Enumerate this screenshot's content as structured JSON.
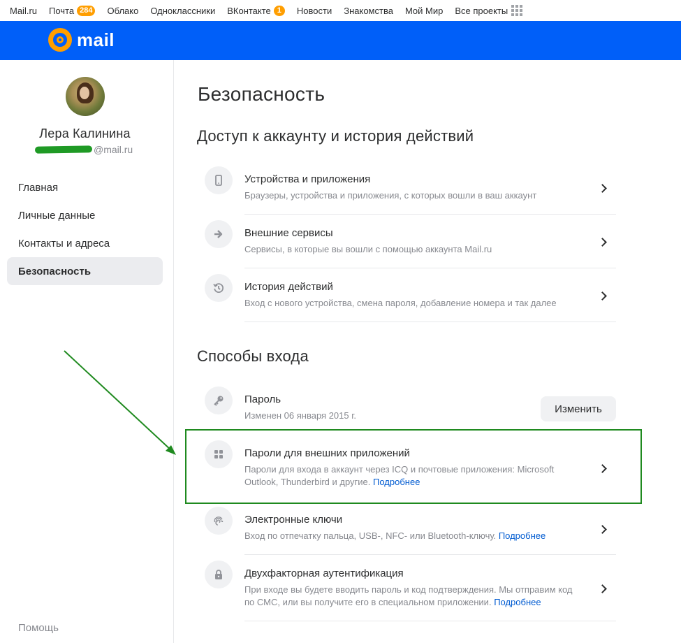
{
  "portal": {
    "items": [
      {
        "label": "Mail.ru"
      },
      {
        "label": "Почта",
        "badge": "284"
      },
      {
        "label": "Облако"
      },
      {
        "label": "Одноклассники"
      },
      {
        "label": "ВКонтакте",
        "badge": "1"
      },
      {
        "label": "Новости"
      },
      {
        "label": "Знакомства"
      },
      {
        "label": "Мой Мир"
      },
      {
        "label": "Все проекты"
      }
    ]
  },
  "header": {
    "logo_text": "mail"
  },
  "user": {
    "name": "Лера Калинина",
    "email_suffix": "@mail.ru"
  },
  "nav": {
    "items": [
      {
        "label": "Главная"
      },
      {
        "label": "Личные данные"
      },
      {
        "label": "Контакты и адреса"
      },
      {
        "label": "Безопасность",
        "active": true
      }
    ],
    "help": "Помощь"
  },
  "page": {
    "title": "Безопасность"
  },
  "access_section": {
    "title": "Доступ к аккаунту и история действий",
    "rows": [
      {
        "title": "Устройства и приложения",
        "desc": "Браузеры, устройства и приложения, с которых вошли в ваш аккаунт",
        "icon": "phone-icon"
      },
      {
        "title": "Внешние сервисы",
        "desc": "Сервисы, в которые вы вошли с помощью аккаунта Mail.ru",
        "icon": "arrow-right-icon"
      },
      {
        "title": "История действий",
        "desc": "Вход с нового устройства, смена пароля, добавление номера и так далее",
        "icon": "history-icon"
      }
    ]
  },
  "login_section": {
    "title": "Способы входа",
    "password": {
      "title": "Пароль",
      "desc": "Изменен 06 января 2015 г.",
      "button": "Изменить",
      "icon": "key-icon"
    },
    "app_passwords": {
      "title": "Пароли для внешних приложений",
      "desc": "Пароли для входа в аккаунт через ICQ и почтовые приложения: Microsoft Outlook, Thunderbird и другие.",
      "link": "Подробнее",
      "icon": "apps-grid-icon"
    },
    "keys": {
      "title": "Электронные ключи",
      "desc": "Вход по отпечатку пальца, USB-, NFC- или Bluetooth-ключу.",
      "link": "Подробнее",
      "icon": "fingerprint-icon"
    },
    "twofa": {
      "title": "Двухфакторная аутентификация",
      "desc": "При входе вы будете вводить пароль и код подтверждения. Мы отправим код по СМС, или вы получите его в специальном приложении.",
      "link": "Подробнее",
      "icon": "lock-icon"
    }
  },
  "annotation_colors": {
    "highlight": "#1f8a1f",
    "arrow": "#1f8a1f"
  }
}
